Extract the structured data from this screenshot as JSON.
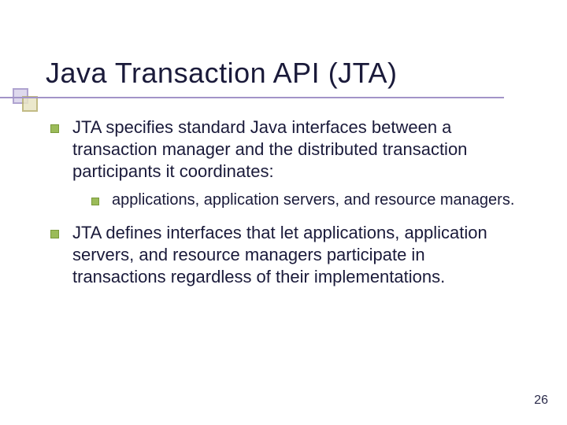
{
  "slide": {
    "title": "Java Transaction API (JTA)",
    "bullets": [
      {
        "text": "JTA specifies standard Java interfaces between a transaction manager and the distributed transaction participants it coordinates:",
        "children": [
          {
            "text": " applications, application servers, and resource managers."
          }
        ]
      },
      {
        "text": "JTA defines interfaces that let applications, application servers, and resource managers participate in transactions regardless of their implementations."
      }
    ],
    "page_number": "26"
  }
}
